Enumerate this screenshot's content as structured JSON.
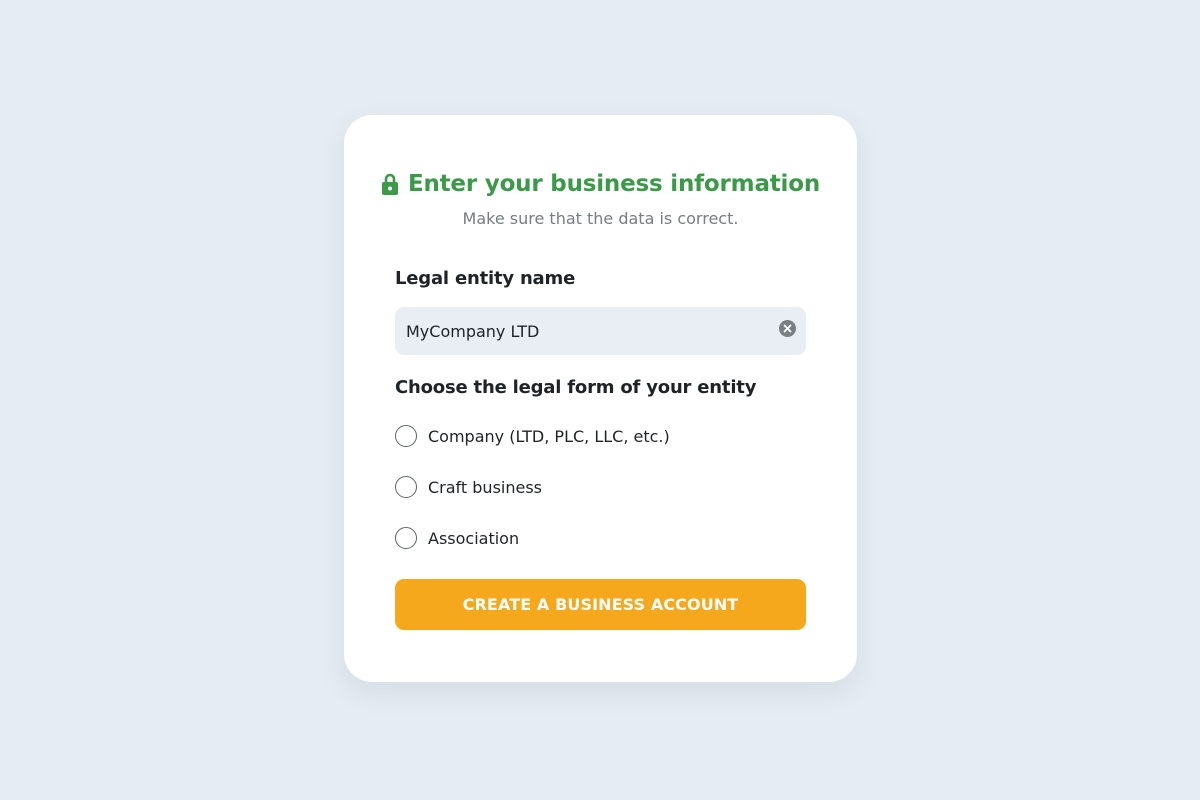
{
  "colors": {
    "background": "#e6ecf3",
    "card": "#ffffff",
    "title_green": "#3a9a48",
    "subtitle_gray": "#777d82",
    "input_bg": "#e8eef4",
    "button_orange": "#f6a81d",
    "button_text": "#ffffff"
  },
  "header": {
    "icon": "lock-icon",
    "title": "Enter your business information",
    "subtitle": "Make sure that the data is correct."
  },
  "entity_name": {
    "label": "Legal entity name",
    "value": "MyCompany LTD",
    "clear_icon": "clear-circle-icon"
  },
  "legal_form": {
    "label": "Choose the legal form of your entity",
    "options": [
      {
        "label": "Company (LTD, PLC, LLC, etc.)",
        "selected": false
      },
      {
        "label": "Craft business",
        "selected": false
      },
      {
        "label": "Association",
        "selected": false
      }
    ]
  },
  "submit": {
    "label": "CREATE A BUSINESS ACCOUNT"
  }
}
